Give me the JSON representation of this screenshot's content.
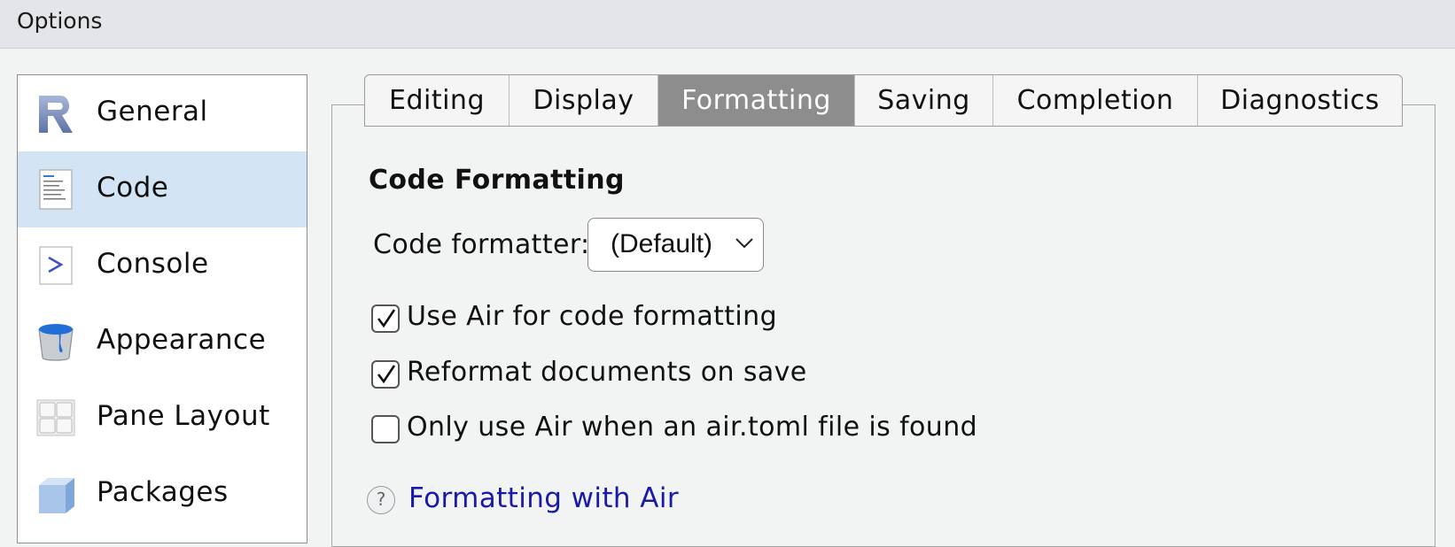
{
  "window": {
    "title": "Options"
  },
  "sidebar": {
    "items": [
      {
        "label": "General",
        "icon": "r-logo-icon"
      },
      {
        "label": "Code",
        "icon": "code-file-icon",
        "selected": true
      },
      {
        "label": "Console",
        "icon": "console-prompt-icon"
      },
      {
        "label": "Appearance",
        "icon": "paint-bucket-icon"
      },
      {
        "label": "Pane Layout",
        "icon": "pane-layout-icon"
      },
      {
        "label": "Packages",
        "icon": "package-box-icon"
      }
    ]
  },
  "tabs": [
    {
      "label": "Editing"
    },
    {
      "label": "Display"
    },
    {
      "label": "Formatting",
      "active": true
    },
    {
      "label": "Saving"
    },
    {
      "label": "Completion"
    },
    {
      "label": "Diagnostics"
    }
  ],
  "formatting": {
    "section_title": "Code Formatting",
    "formatter_label": "Code formatter:",
    "formatter_value": "(Default)",
    "options": [
      {
        "label": "Use Air for code formatting",
        "checked": true
      },
      {
        "label": "Reformat documents on save",
        "checked": true
      },
      {
        "label": "Only use Air when an air.toml file is found",
        "checked": false
      }
    ],
    "help_link": "Formatting with Air",
    "help_icon_glyph": "?"
  },
  "colors": {
    "selected_item_bg": "#d3e5f5",
    "active_tab_bg": "#8d8d8d",
    "link": "#1a1aa8"
  }
}
